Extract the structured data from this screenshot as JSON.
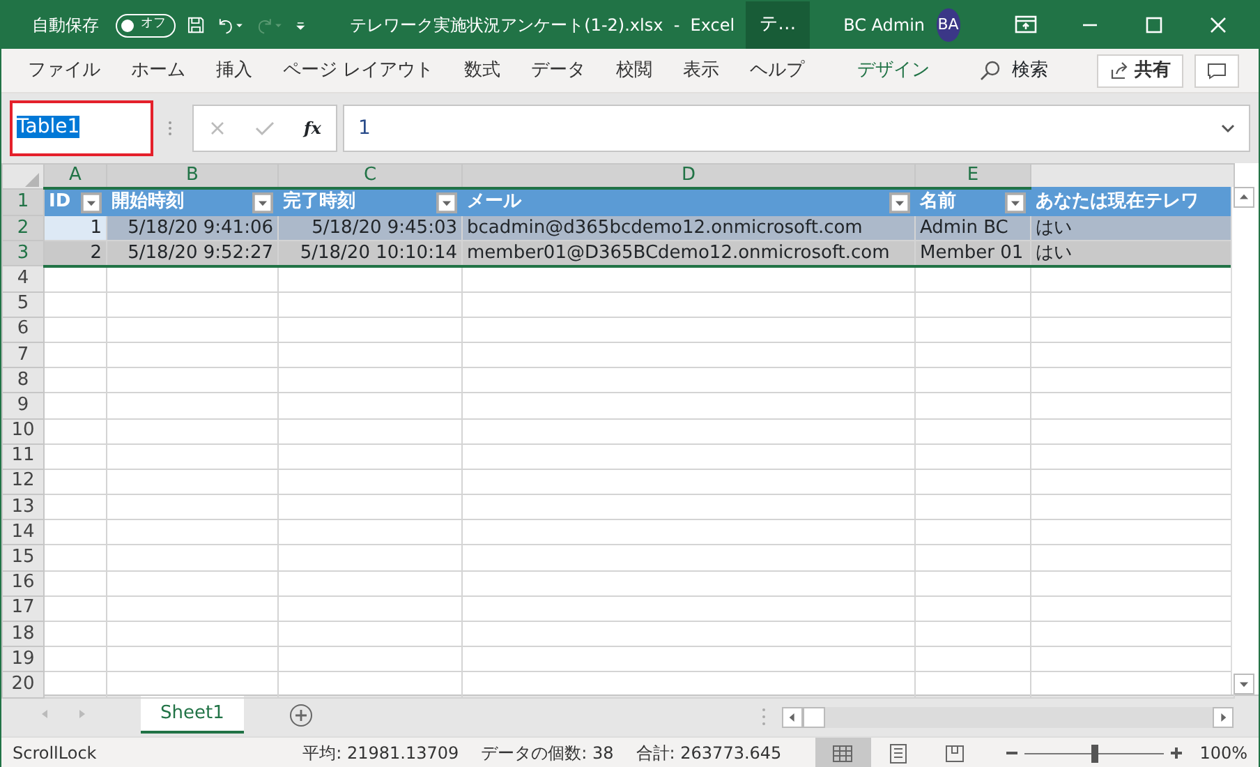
{
  "title_bar": {
    "autosave_label": "自動保存",
    "autosave_toggle": {
      "label": "オフ",
      "on": false
    },
    "redo_disabled": true,
    "document_title": "テレワーク実施状況アンケート(1-2).xlsx  -  Excel",
    "context_tab": "テ…",
    "user_name": "BC Admin",
    "avatar_initials": "BA"
  },
  "ribbon_tabs": [
    {
      "label": "ファイル",
      "kind": "normal"
    },
    {
      "label": "ホーム",
      "kind": "normal"
    },
    {
      "label": "挿入",
      "kind": "normal"
    },
    {
      "label": "ページ レイアウト",
      "kind": "normal"
    },
    {
      "label": "数式",
      "kind": "normal"
    },
    {
      "label": "データ",
      "kind": "normal"
    },
    {
      "label": "校閲",
      "kind": "normal"
    },
    {
      "label": "表示",
      "kind": "normal"
    },
    {
      "label": "ヘルプ",
      "kind": "normal"
    },
    {
      "label": "デザイン",
      "kind": "contextual"
    }
  ],
  "search": {
    "label": "検索"
  },
  "share_button": "共有",
  "formula_bar": {
    "name_box": "Table1",
    "fx": "fx",
    "value": "1"
  },
  "sheet": {
    "columns": [
      {
        "label": "A",
        "selected": true
      },
      {
        "label": "B",
        "selected": true
      },
      {
        "label": "C",
        "selected": true
      },
      {
        "label": "D",
        "selected": true
      },
      {
        "label": "E",
        "selected": true
      }
    ],
    "table_headers": [
      {
        "label": "ID",
        "kind": "number"
      },
      {
        "label": "開始時刻",
        "kind": "number"
      },
      {
        "label": "完了時刻",
        "kind": "number"
      },
      {
        "label": "メール",
        "kind": "text"
      },
      {
        "label": "名前",
        "kind": "text"
      },
      {
        "label": "あなたは現在テレワ",
        "kind": "text"
      }
    ],
    "rows": [
      {
        "selected": true,
        "cells": [
          {
            "text": "1",
            "active": true
          },
          {
            "text": "5/18/20 9:41:06",
            "active": false
          },
          {
            "text": "5/18/20 9:45:03",
            "active": false
          },
          {
            "text": "bcadmin@d365bcdemo12.onmicrosoft.com",
            "active": false
          },
          {
            "text": "Admin BC",
            "active": false
          },
          {
            "text": "はい",
            "active": false
          }
        ]
      },
      {
        "selected": true,
        "cells": [
          {
            "text": "2",
            "active": false
          },
          {
            "text": "5/18/20 9:52:27",
            "active": false
          },
          {
            "text": "5/18/20 10:10:14",
            "active": false
          },
          {
            "text": "member01@D365BCdemo12.onmicrosoft.com",
            "active": false
          },
          {
            "text": "Member 01",
            "active": false
          },
          {
            "text": "はい",
            "active": false
          }
        ]
      }
    ],
    "row_numbers": [
      "1",
      "2",
      "3",
      "4",
      "5",
      "6",
      "7",
      "8",
      "9",
      "10",
      "11",
      "12",
      "13",
      "14",
      "15",
      "16",
      "17",
      "18",
      "19",
      "20"
    ]
  },
  "sheet_tabs": [
    {
      "label": "Sheet1",
      "selected": true
    }
  ],
  "status_bar": {
    "mode": "ScrollLock",
    "average": "平均: 21981.13709",
    "count": "データの個数: 38",
    "sum": "合計: 263773.645",
    "views": [
      {
        "kind": "normal",
        "selected": true
      },
      {
        "kind": "page_layout",
        "selected": false
      },
      {
        "kind": "page_break",
        "selected": false
      }
    ],
    "zoom": {
      "level": 0.5,
      "label": "100%"
    }
  }
}
